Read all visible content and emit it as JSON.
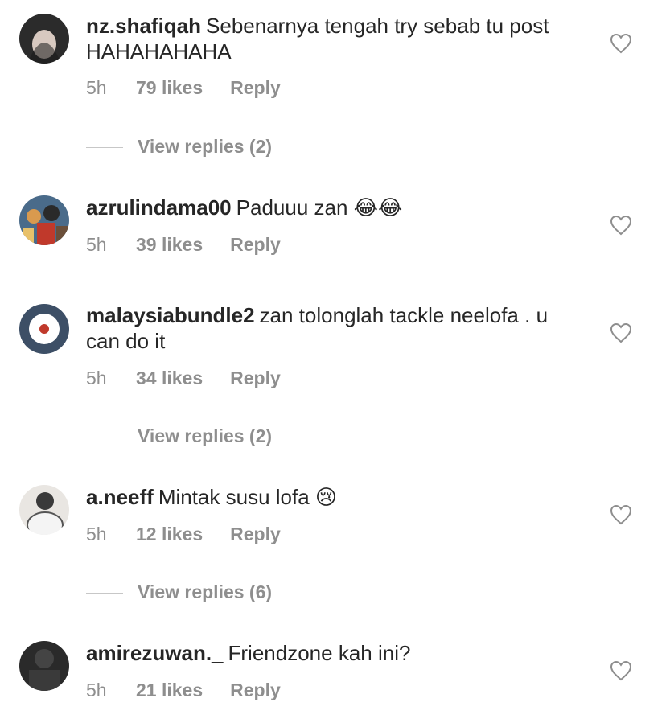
{
  "comments": [
    {
      "username": "nz.shafiqah",
      "text": "Sebenarnya tengah try sebab tu post HAHAHAHAHA",
      "age": "5h",
      "likes": "79 likes",
      "reply_label": "Reply",
      "view_replies": "View replies (2)"
    },
    {
      "username": "azrulindama00",
      "text": "Paduuu zan 😂😂",
      "age": "5h",
      "likes": "39 likes",
      "reply_label": "Reply"
    },
    {
      "username": "malaysiabundle2",
      "text": "zan tolonglah tackle neelofa . u can do it",
      "age": "5h",
      "likes": "34 likes",
      "reply_label": "Reply",
      "view_replies": "View replies (2)"
    },
    {
      "username": "a.neeff",
      "text": "Mintak susu lofa 😢",
      "age": "5h",
      "likes": "12 likes",
      "reply_label": "Reply",
      "view_replies": "View replies (6)"
    },
    {
      "username": "amirezuwan._",
      "text": "Friendzone kah ini?",
      "age": "5h",
      "likes": "21 likes",
      "reply_label": "Reply"
    }
  ],
  "icons": {
    "heart": "heart-outline-icon",
    "avatar": "avatar"
  },
  "colors": {
    "text": "#262626",
    "muted": "#8e8e8e",
    "divider": "#c7c7c7"
  }
}
